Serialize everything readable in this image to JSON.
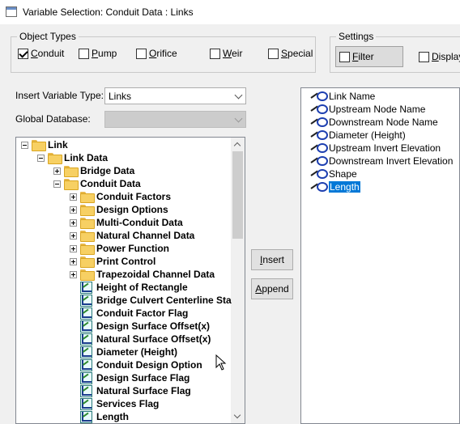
{
  "window": {
    "title": "Variable Selection: Conduit Data : Links"
  },
  "object_types": {
    "legend": "Object Types",
    "items": [
      {
        "label": "Conduit",
        "underline": "C",
        "rest": "onduit",
        "checked": true
      },
      {
        "label": "Pump",
        "underline": "P",
        "rest": "ump",
        "checked": false
      },
      {
        "label": "Orifice",
        "underline": "O",
        "rest": "rifice",
        "checked": false
      },
      {
        "label": "Weir",
        "underline": "W",
        "rest": "eir",
        "checked": false
      },
      {
        "label": "Special",
        "underline": "S",
        "rest": "pecial",
        "checked": false
      }
    ]
  },
  "settings": {
    "legend": "Settings",
    "filter": {
      "label": "Filter",
      "underline": "F",
      "rest": "ilter",
      "checked": false
    },
    "display": {
      "label": "Display",
      "underline": "D",
      "rest": "isplay",
      "checked": false
    }
  },
  "insert_variable_type": {
    "label": "Insert Variable Type:",
    "value": "Links"
  },
  "global_database": {
    "label": "Global Database:",
    "value": ""
  },
  "tree": [
    {
      "text": "Link",
      "kind": "folder",
      "level": 0,
      "expander": "minus"
    },
    {
      "text": "Link Data",
      "kind": "folder",
      "level": 1,
      "expander": "minus"
    },
    {
      "text": "Bridge Data",
      "kind": "folder",
      "level": 2,
      "expander": "plus"
    },
    {
      "text": "Conduit Data",
      "kind": "folder",
      "level": 2,
      "expander": "minus"
    },
    {
      "text": "Conduit Factors",
      "kind": "folder",
      "level": 3,
      "expander": "plus"
    },
    {
      "text": "Design Options",
      "kind": "folder",
      "level": 3,
      "expander": "plus"
    },
    {
      "text": "Multi-Conduit Data",
      "kind": "folder",
      "level": 3,
      "expander": "plus"
    },
    {
      "text": "Natural Channel Data",
      "kind": "folder",
      "level": 3,
      "expander": "plus"
    },
    {
      "text": "Power Function",
      "kind": "folder",
      "level": 3,
      "expander": "plus"
    },
    {
      "text": "Print Control",
      "kind": "folder",
      "level": 3,
      "expander": "plus"
    },
    {
      "text": "Trapezoidal Channel Data",
      "kind": "folder",
      "level": 3,
      "expander": "plus"
    },
    {
      "text": "Height of Rectangle",
      "kind": "variable",
      "level": 3
    },
    {
      "text": "Bridge Culvert Centerline Sta",
      "kind": "variable",
      "level": 3
    },
    {
      "text": "Conduit Factor Flag",
      "kind": "variable",
      "level": 3
    },
    {
      "text": "Design Surface Offset(x)",
      "kind": "variable",
      "level": 3
    },
    {
      "text": "Natural Surface Offset(x)",
      "kind": "variable",
      "level": 3
    },
    {
      "text": "Diameter (Height)",
      "kind": "variable",
      "level": 3
    },
    {
      "text": "Conduit Design Option",
      "kind": "variable",
      "level": 3
    },
    {
      "text": "Design Surface Flag",
      "kind": "variable",
      "level": 3
    },
    {
      "text": "Natural Surface Flag",
      "kind": "variable",
      "level": 3
    },
    {
      "text": "Services Flag",
      "kind": "variable",
      "level": 3
    },
    {
      "text": "Length",
      "kind": "variable",
      "level": 3
    }
  ],
  "buttons": {
    "insert": {
      "underline": "I",
      "rest": "nsert"
    },
    "append": {
      "underline": "A",
      "rest": "ppend"
    }
  },
  "selected_variables": [
    {
      "text": "Link Name",
      "selected": false
    },
    {
      "text": "Upstream Node Name",
      "selected": false
    },
    {
      "text": "Downstream Node Name",
      "selected": false
    },
    {
      "text": "Diameter (Height)",
      "selected": false
    },
    {
      "text": "Upstream Invert Elevation",
      "selected": false
    },
    {
      "text": "Downstream Invert Elevation",
      "selected": false
    },
    {
      "text": "Shape",
      "selected": false
    },
    {
      "text": "Length",
      "selected": true
    }
  ]
}
